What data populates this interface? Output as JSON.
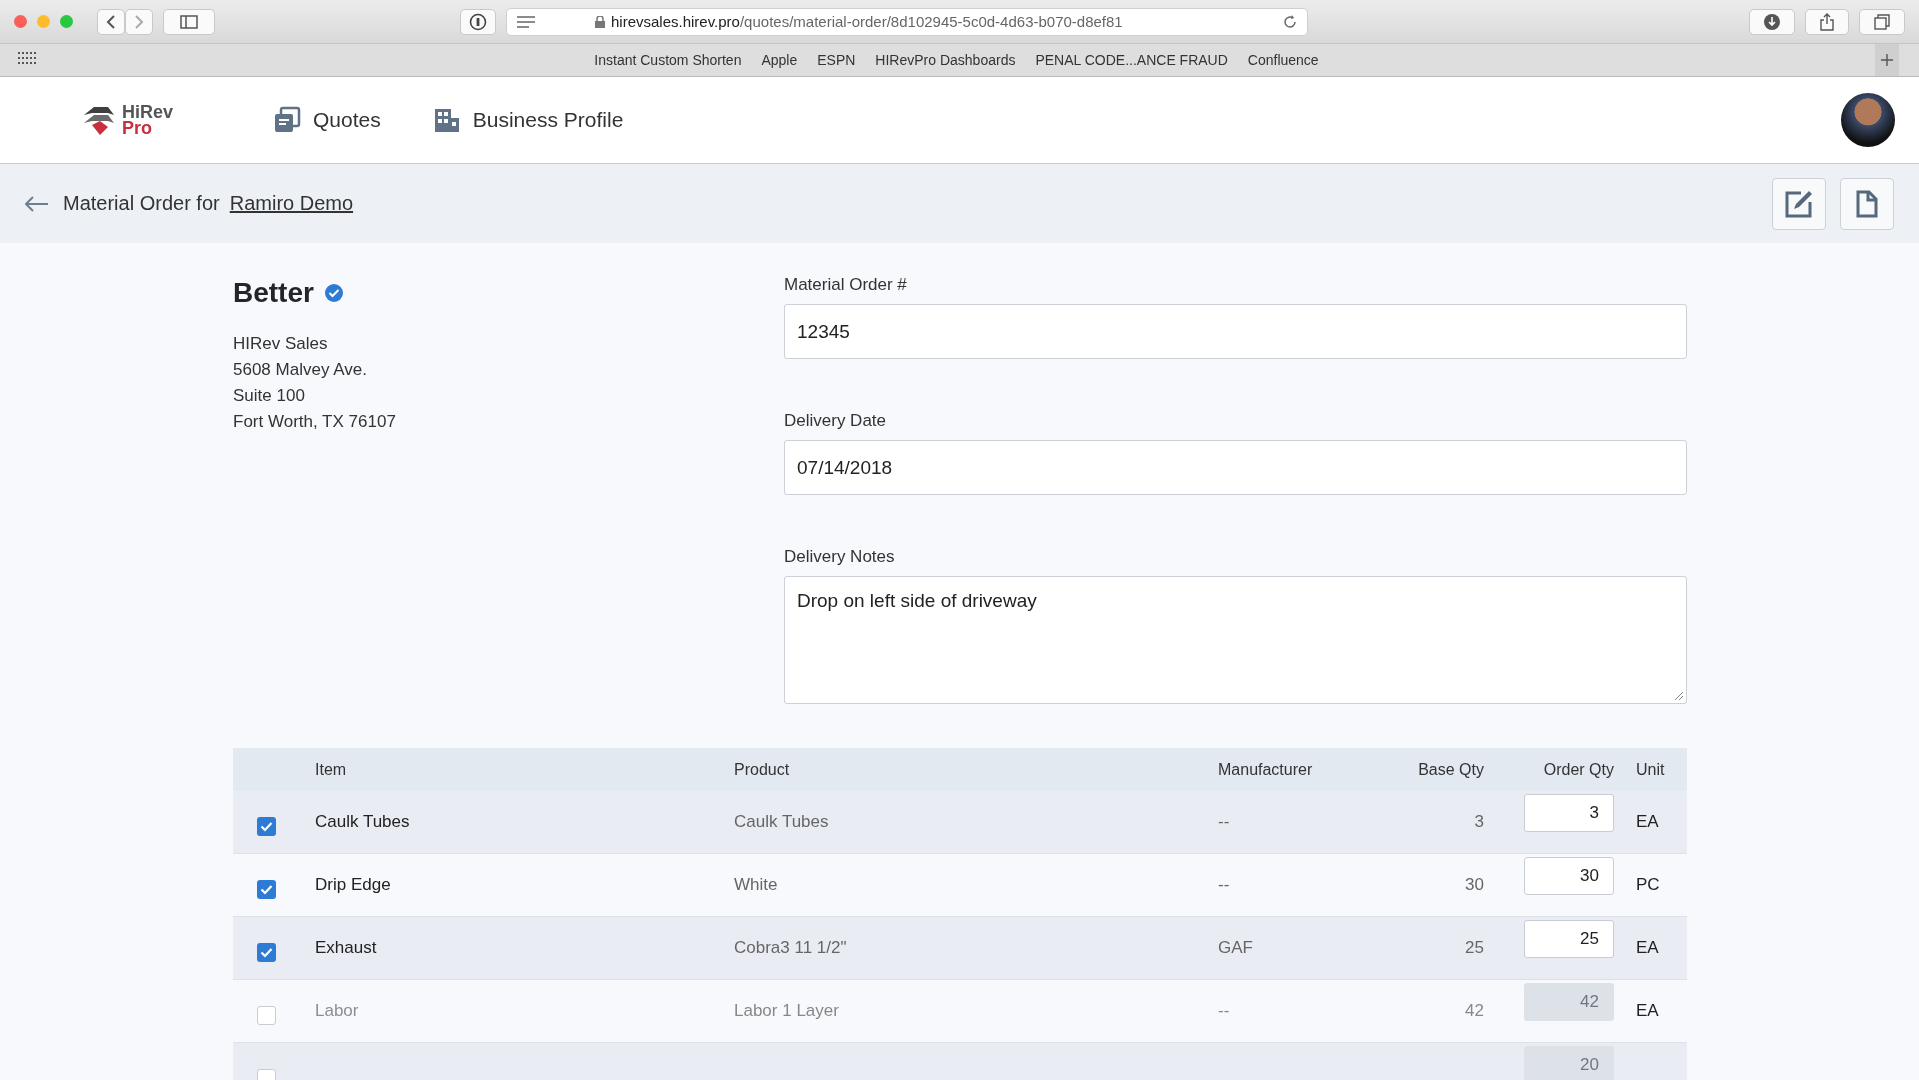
{
  "browser": {
    "url_host": "hirevsales.hirev.pro",
    "url_path": "/quotes/material-order/8d102945-5c0d-4d63-b070-d8ef81",
    "bookmarks": [
      "Instant Custom Shorten",
      "Apple",
      "ESPN",
      "HIRevPro Dashboards",
      "PENAL CODE...ANCE FRAUD",
      "Confluence"
    ]
  },
  "nav": {
    "logo_top": "HiRev",
    "logo_bottom": "Pro",
    "items": [
      {
        "label": "Quotes"
      },
      {
        "label": "Business Profile"
      }
    ]
  },
  "page_header": {
    "title": "Material Order for",
    "customer": "Ramiro Demo"
  },
  "quote": {
    "name": "Better",
    "verified": true,
    "address": [
      "HIRev Sales",
      "5608 Malvey Ave.",
      "Suite 100",
      "Fort Worth, TX 76107"
    ]
  },
  "form": {
    "order_number": {
      "label": "Material Order #",
      "value": "12345"
    },
    "delivery_date": {
      "label": "Delivery Date",
      "value": "07/14/2018"
    },
    "delivery_notes": {
      "label": "Delivery Notes",
      "value": "Drop on left side of driveway"
    }
  },
  "table": {
    "columns": [
      "Item",
      "Product",
      "Manufacturer",
      "Base Qty",
      "Order Qty",
      "Unit"
    ],
    "rows": [
      {
        "checked": true,
        "item": "Caulk Tubes",
        "product": "Caulk Tubes",
        "manufacturer": "--",
        "base_qty": "3",
        "order_qty": "3",
        "unit": "EA"
      },
      {
        "checked": true,
        "item": "Drip Edge",
        "product": "White",
        "manufacturer": "--",
        "base_qty": "30",
        "order_qty": "30",
        "unit": "PC"
      },
      {
        "checked": true,
        "item": "Exhaust",
        "product": "Cobra3 11 1/2\"",
        "manufacturer": "GAF",
        "base_qty": "25",
        "order_qty": "25",
        "unit": "EA"
      },
      {
        "checked": false,
        "item": "Labor",
        "product": "Labor 1 Layer",
        "manufacturer": "--",
        "base_qty": "42",
        "order_qty": "42",
        "unit": "EA"
      },
      {
        "checked": false,
        "order_qty": "20"
      }
    ]
  }
}
